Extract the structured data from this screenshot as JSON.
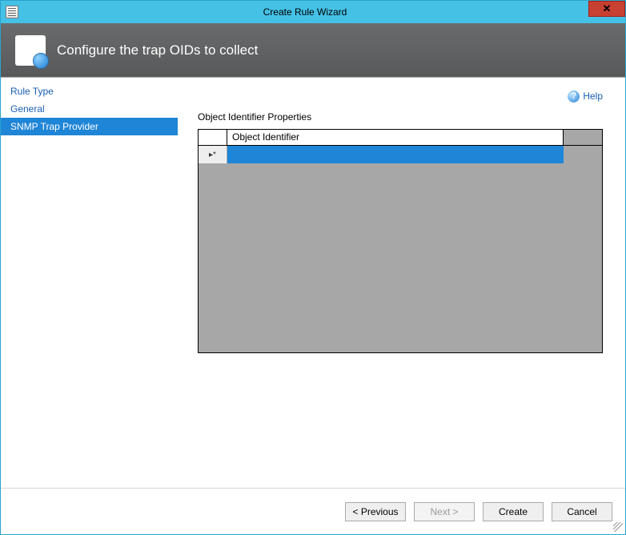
{
  "title": "Create Rule Wizard",
  "banner": {
    "text": "Configure the trap OIDs to collect"
  },
  "sidebar": {
    "items": [
      {
        "label": "Rule Type",
        "active": false
      },
      {
        "label": "General",
        "active": false
      },
      {
        "label": "SNMP Trap Provider",
        "active": true
      }
    ]
  },
  "help": {
    "label": "Help"
  },
  "content": {
    "section_label": "Object Identifier Properties",
    "column_header": "Object Identifier",
    "row_marker": "▸*",
    "row_value": ""
  },
  "buttons": {
    "previous": "< Previous",
    "next": "Next >",
    "create": "Create",
    "cancel": "Cancel",
    "next_enabled": false
  }
}
